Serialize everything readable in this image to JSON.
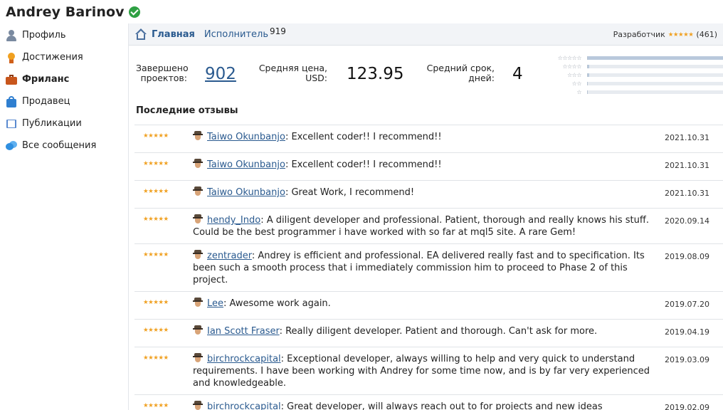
{
  "user": {
    "name": "Andrey Barinov"
  },
  "sidebar": {
    "items": [
      {
        "label": "Профиль",
        "icon": "profile-icon"
      },
      {
        "label": "Достижения",
        "icon": "achievement-icon"
      },
      {
        "label": "Фриланс",
        "icon": "briefcase-icon",
        "active": true
      },
      {
        "label": "Продавец",
        "icon": "bag-icon"
      },
      {
        "label": "Публикации",
        "icon": "book-icon"
      },
      {
        "label": "Все сообщения",
        "icon": "messages-icon"
      }
    ]
  },
  "topbar": {
    "home_label": "Главная",
    "executor_label": "Исполнитель",
    "executor_count": "919",
    "developer_label": "Разработчик",
    "developer_stars": "★★★★★",
    "developer_reviews": "(461)"
  },
  "stats": {
    "completed_label_1": "Завершено",
    "completed_label_2": "проектов:",
    "completed_value": "902",
    "avg_price_label_1": "Средняя цена,",
    "avg_price_label_2": "USD:",
    "avg_price_value": "123.95",
    "avg_term_label_1": "Средний срок,",
    "avg_term_label_2": "дней:",
    "avg_term_value": "4"
  },
  "rating_distribution": [
    {
      "stars": "☆☆☆☆☆",
      "fraction": 1.0
    },
    {
      "stars": "☆☆☆☆",
      "fraction": 0.01
    },
    {
      "stars": "☆☆☆",
      "fraction": 0.01
    },
    {
      "stars": "☆☆",
      "fraction": 0.0
    },
    {
      "stars": "☆",
      "fraction": 0.0
    }
  ],
  "reviews_title": "Последние отзывы",
  "reviews": [
    {
      "stars": "★★★★★",
      "author": "Taiwo Okunbanjo",
      "text": ": Excellent coder!! I recommend!!",
      "date": "2021.10.31"
    },
    {
      "stars": "★★★★★",
      "author": "Taiwo Okunbanjo",
      "text": ": Excellent coder!! I recommend!!",
      "date": "2021.10.31"
    },
    {
      "stars": "★★★★★",
      "author": "Taiwo Okunbanjo",
      "text": ": Great Work, I recommend!",
      "date": "2021.10.31"
    },
    {
      "stars": "★★★★★",
      "author": "hendy_Indo",
      "text": ": A diligent developer and professional. Patient, thorough and really knows his stuff. Could be the best programmer i have worked with so far at mql5 site. A rare Gem!",
      "date": "2020.09.14"
    },
    {
      "stars": "★★★★★",
      "author": "zentrader",
      "text": ": Andrey is efficient and professional. EA delivered really fast and to specification. Its been such a smooth process that i immediately commission him to proceed to Phase 2 of this project.",
      "date": "2019.08.09"
    },
    {
      "stars": "★★★★★",
      "author": "Lee",
      "text": ": Awesome work again.",
      "date": "2019.07.20"
    },
    {
      "stars": "★★★★★",
      "author": "Ian Scott Fraser",
      "text": ": Really diligent developer. Patient and thorough. Can't ask for more.",
      "date": "2019.04.19"
    },
    {
      "stars": "★★★★★",
      "author": "birchrockcapital",
      "text": ": Exceptional developer, always willing to help and very quick to understand requirements. I have been working with Andrey for some time now, and is by far very experienced and knowledgeable.",
      "date": "2019.03.09"
    },
    {
      "stars": "★★★★★",
      "author": "birchrockcapital",
      "text": ": Great developer, will always reach out to for projects and new ideas",
      "date": "2019.02.09"
    }
  ]
}
